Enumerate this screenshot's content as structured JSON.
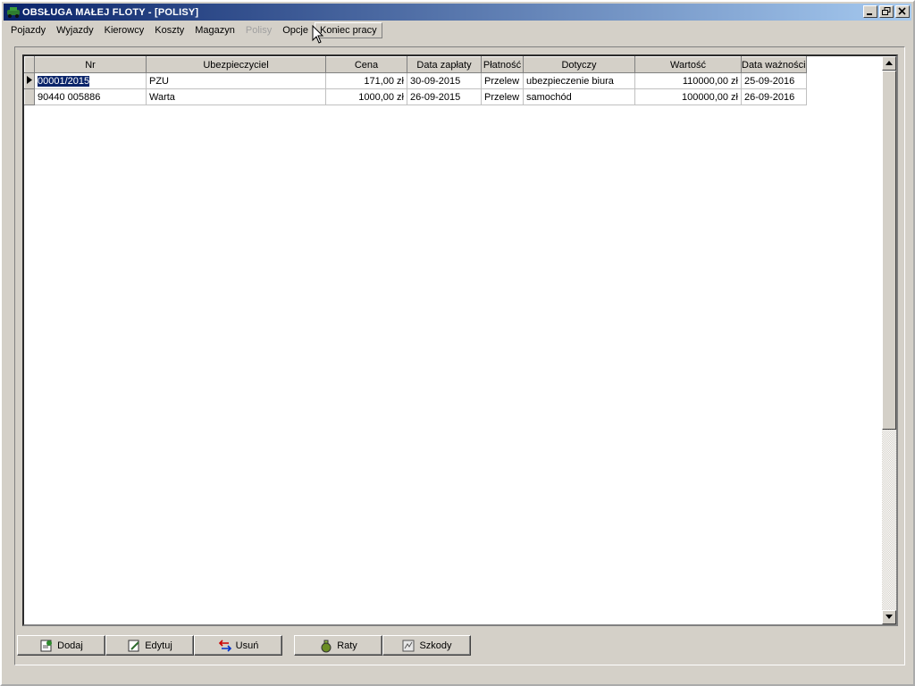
{
  "window": {
    "title": "OBSŁUGA MAŁEJ FLOTY - [POLISY]"
  },
  "menu": [
    {
      "label": "Pojazdy",
      "enabled": true
    },
    {
      "label": "Wyjazdy",
      "enabled": true
    },
    {
      "label": "Kierowcy",
      "enabled": true
    },
    {
      "label": "Koszty",
      "enabled": true
    },
    {
      "label": "Magazyn",
      "enabled": true
    },
    {
      "label": "Polisy",
      "enabled": false
    },
    {
      "label": "Opcje",
      "enabled": true
    },
    {
      "label": "Koniec pracy",
      "enabled": true
    }
  ],
  "grid": {
    "columns": [
      "Nr",
      "Ubezpieczyciel",
      "Cena",
      "Data zapłaty",
      "Płatność",
      "Dotyczy",
      "Wartość",
      "Data ważności"
    ],
    "rows": [
      [
        "00001/2015",
        "PZU",
        "171,00 zł",
        "30-09-2015",
        "Przelew",
        "ubezpieczenie biura",
        "110000,00 zł",
        "25-09-2016"
      ],
      [
        "90440 005886",
        "Warta",
        "1000,00 zł",
        "26-09-2015",
        "Przelew",
        "samochód",
        "100000,00 zł",
        "26-09-2016"
      ]
    ],
    "selected_row": 0
  },
  "buttons": {
    "add": "Dodaj",
    "edit": "Edytuj",
    "delete": "Usuń",
    "installments": "Raty",
    "damages": "Szkody"
  },
  "colors": {
    "titlebar": "#0a246a",
    "selection": "#0a246a",
    "face": "#d4d0c8"
  }
}
